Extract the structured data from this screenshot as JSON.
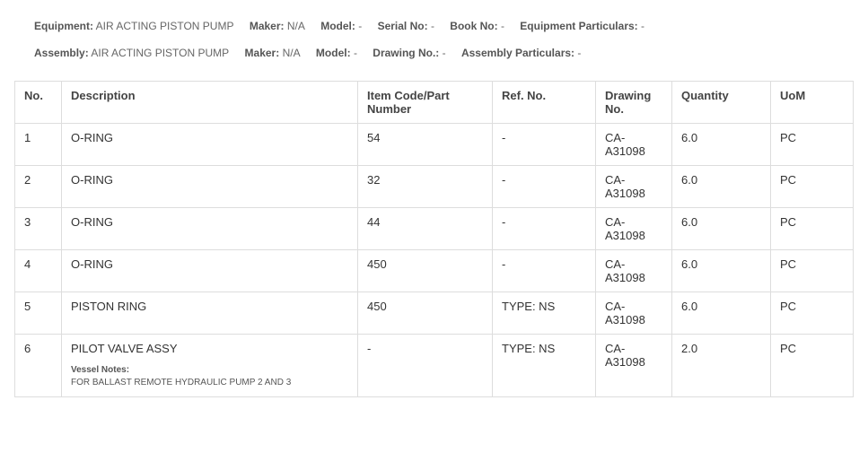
{
  "meta": {
    "equipment": {
      "label": "Equipment:",
      "value": "AIR ACTING PISTON PUMP"
    },
    "eq_maker": {
      "label": "Maker:",
      "value": "N/A"
    },
    "eq_model": {
      "label": "Model:",
      "value": "-"
    },
    "eq_serial": {
      "label": "Serial No:",
      "value": "-"
    },
    "eq_book": {
      "label": "Book No:",
      "value": "-"
    },
    "eq_part": {
      "label": "Equipment Particulars:",
      "value": "-"
    },
    "assembly": {
      "label": "Assembly:",
      "value": "AIR ACTING PISTON PUMP"
    },
    "as_maker": {
      "label": "Maker:",
      "value": "N/A"
    },
    "as_model": {
      "label": "Model:",
      "value": "-"
    },
    "as_draw": {
      "label": "Drawing No.:",
      "value": "-"
    },
    "as_part": {
      "label": "Assembly Particulars:",
      "value": "-"
    }
  },
  "columns": {
    "no": "No.",
    "desc": "Description",
    "item": "Item Code/Part Number",
    "ref": "Ref. No.",
    "draw": "Drawing No.",
    "qty": "Quantity",
    "uom": "UoM"
  },
  "vessel_notes_label": "Vessel Notes",
  "rows": [
    {
      "no": "1",
      "desc": "O-RING",
      "item": "54",
      "ref": "-",
      "draw": "CA-A31098",
      "qty": "6.0",
      "uom": "PC"
    },
    {
      "no": "2",
      "desc": "O-RING",
      "item": "32",
      "ref": "-",
      "draw": "CA-A31098",
      "qty": "6.0",
      "uom": "PC"
    },
    {
      "no": "3",
      "desc": "O-RING",
      "item": "44",
      "ref": "-",
      "draw": "CA-A31098",
      "qty": "6.0",
      "uom": "PC"
    },
    {
      "no": "4",
      "desc": "O-RING",
      "item": "450",
      "ref": "-",
      "draw": "CA-A31098",
      "qty": "6.0",
      "uom": "PC"
    },
    {
      "no": "5",
      "desc": "PISTON RING",
      "item": "450",
      "ref": "TYPE: NS",
      "draw": "CA-A31098",
      "qty": "6.0",
      "uom": "PC"
    },
    {
      "no": "6",
      "desc": "PILOT VALVE ASSY",
      "item": "-",
      "ref": "TYPE: NS",
      "draw": "CA-A31098",
      "qty": "2.0",
      "uom": "PC",
      "notes": "FOR BALLAST REMOTE HYDRAULIC PUMP 2 AND 3"
    }
  ]
}
